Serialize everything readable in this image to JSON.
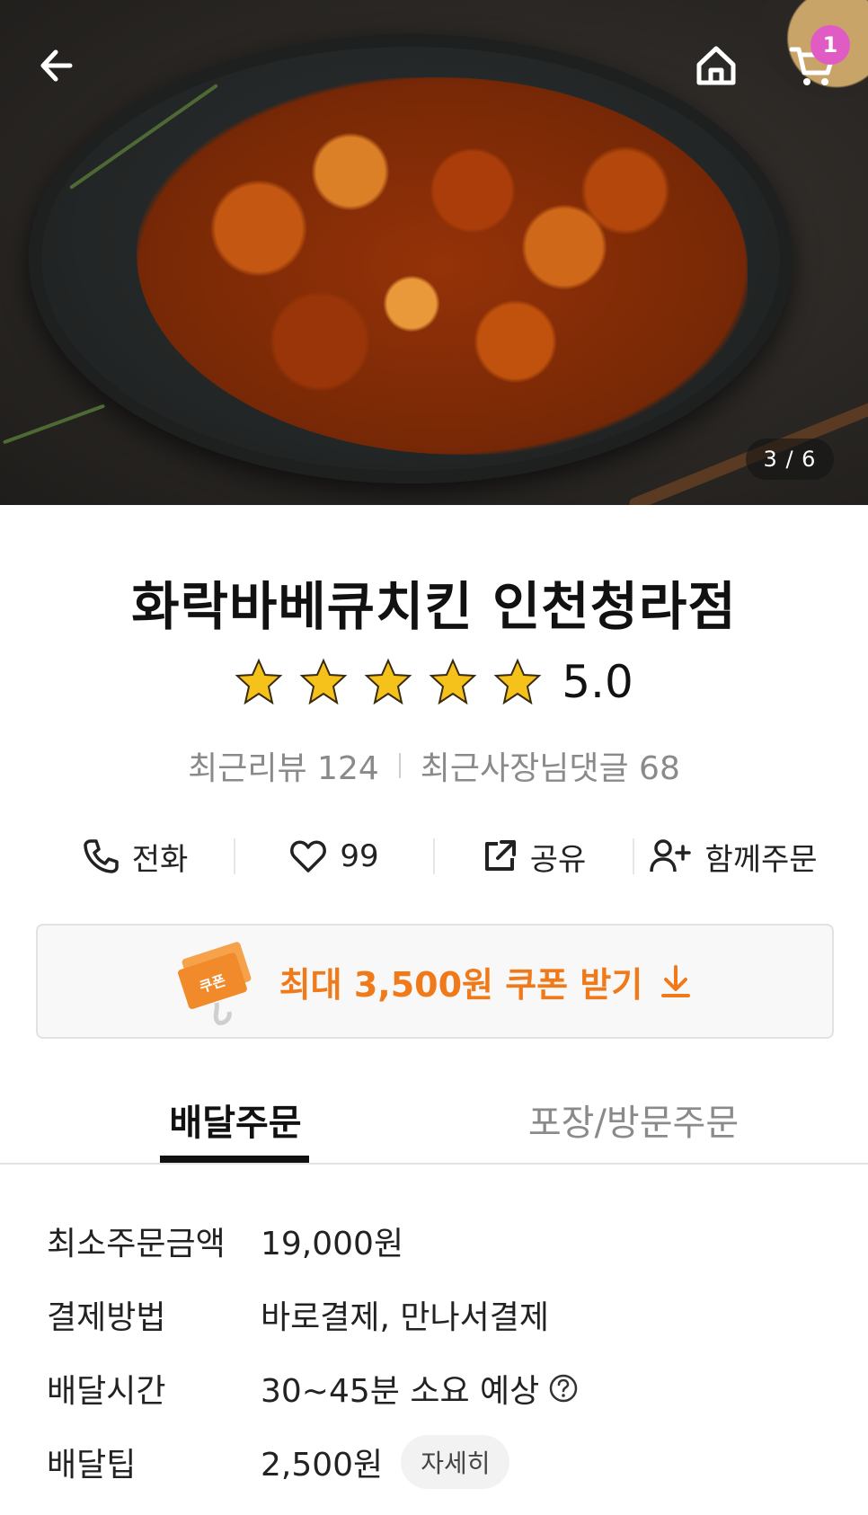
{
  "header": {
    "back_icon": "arrow-left-icon",
    "home_icon": "home-icon",
    "cart_icon": "cart-icon",
    "cart_count": "1",
    "image_counter": "3 / 6"
  },
  "store": {
    "name": "화락바베큐치킨 인천청라점",
    "rating": "5.0",
    "stars": 5,
    "recent_reviews": "최근리뷰 124",
    "owner_replies": "최근사장님댓글 68"
  },
  "actions": {
    "call_label": "전화",
    "like_count": "99",
    "share_label": "공유",
    "group_order_label": "함께주문"
  },
  "coupon": {
    "label": "최대 3,500원 쿠폰 받기",
    "tag_text": "쿠폰",
    "accent": "#f07a1a"
  },
  "tabs": [
    {
      "label": "배달주문",
      "active": true
    },
    {
      "label": "포장/방문주문",
      "active": false
    }
  ],
  "info": {
    "min_order_label": "최소주문금액",
    "min_order_value": "19,000원",
    "payment_label": "결제방법",
    "payment_value": "바로결제, 만나서결제",
    "time_label": "배달시간",
    "time_value": "30~45분 소요 예상",
    "tip_label": "배달팁",
    "tip_value": "2,500원",
    "tip_detail": "자세히"
  }
}
